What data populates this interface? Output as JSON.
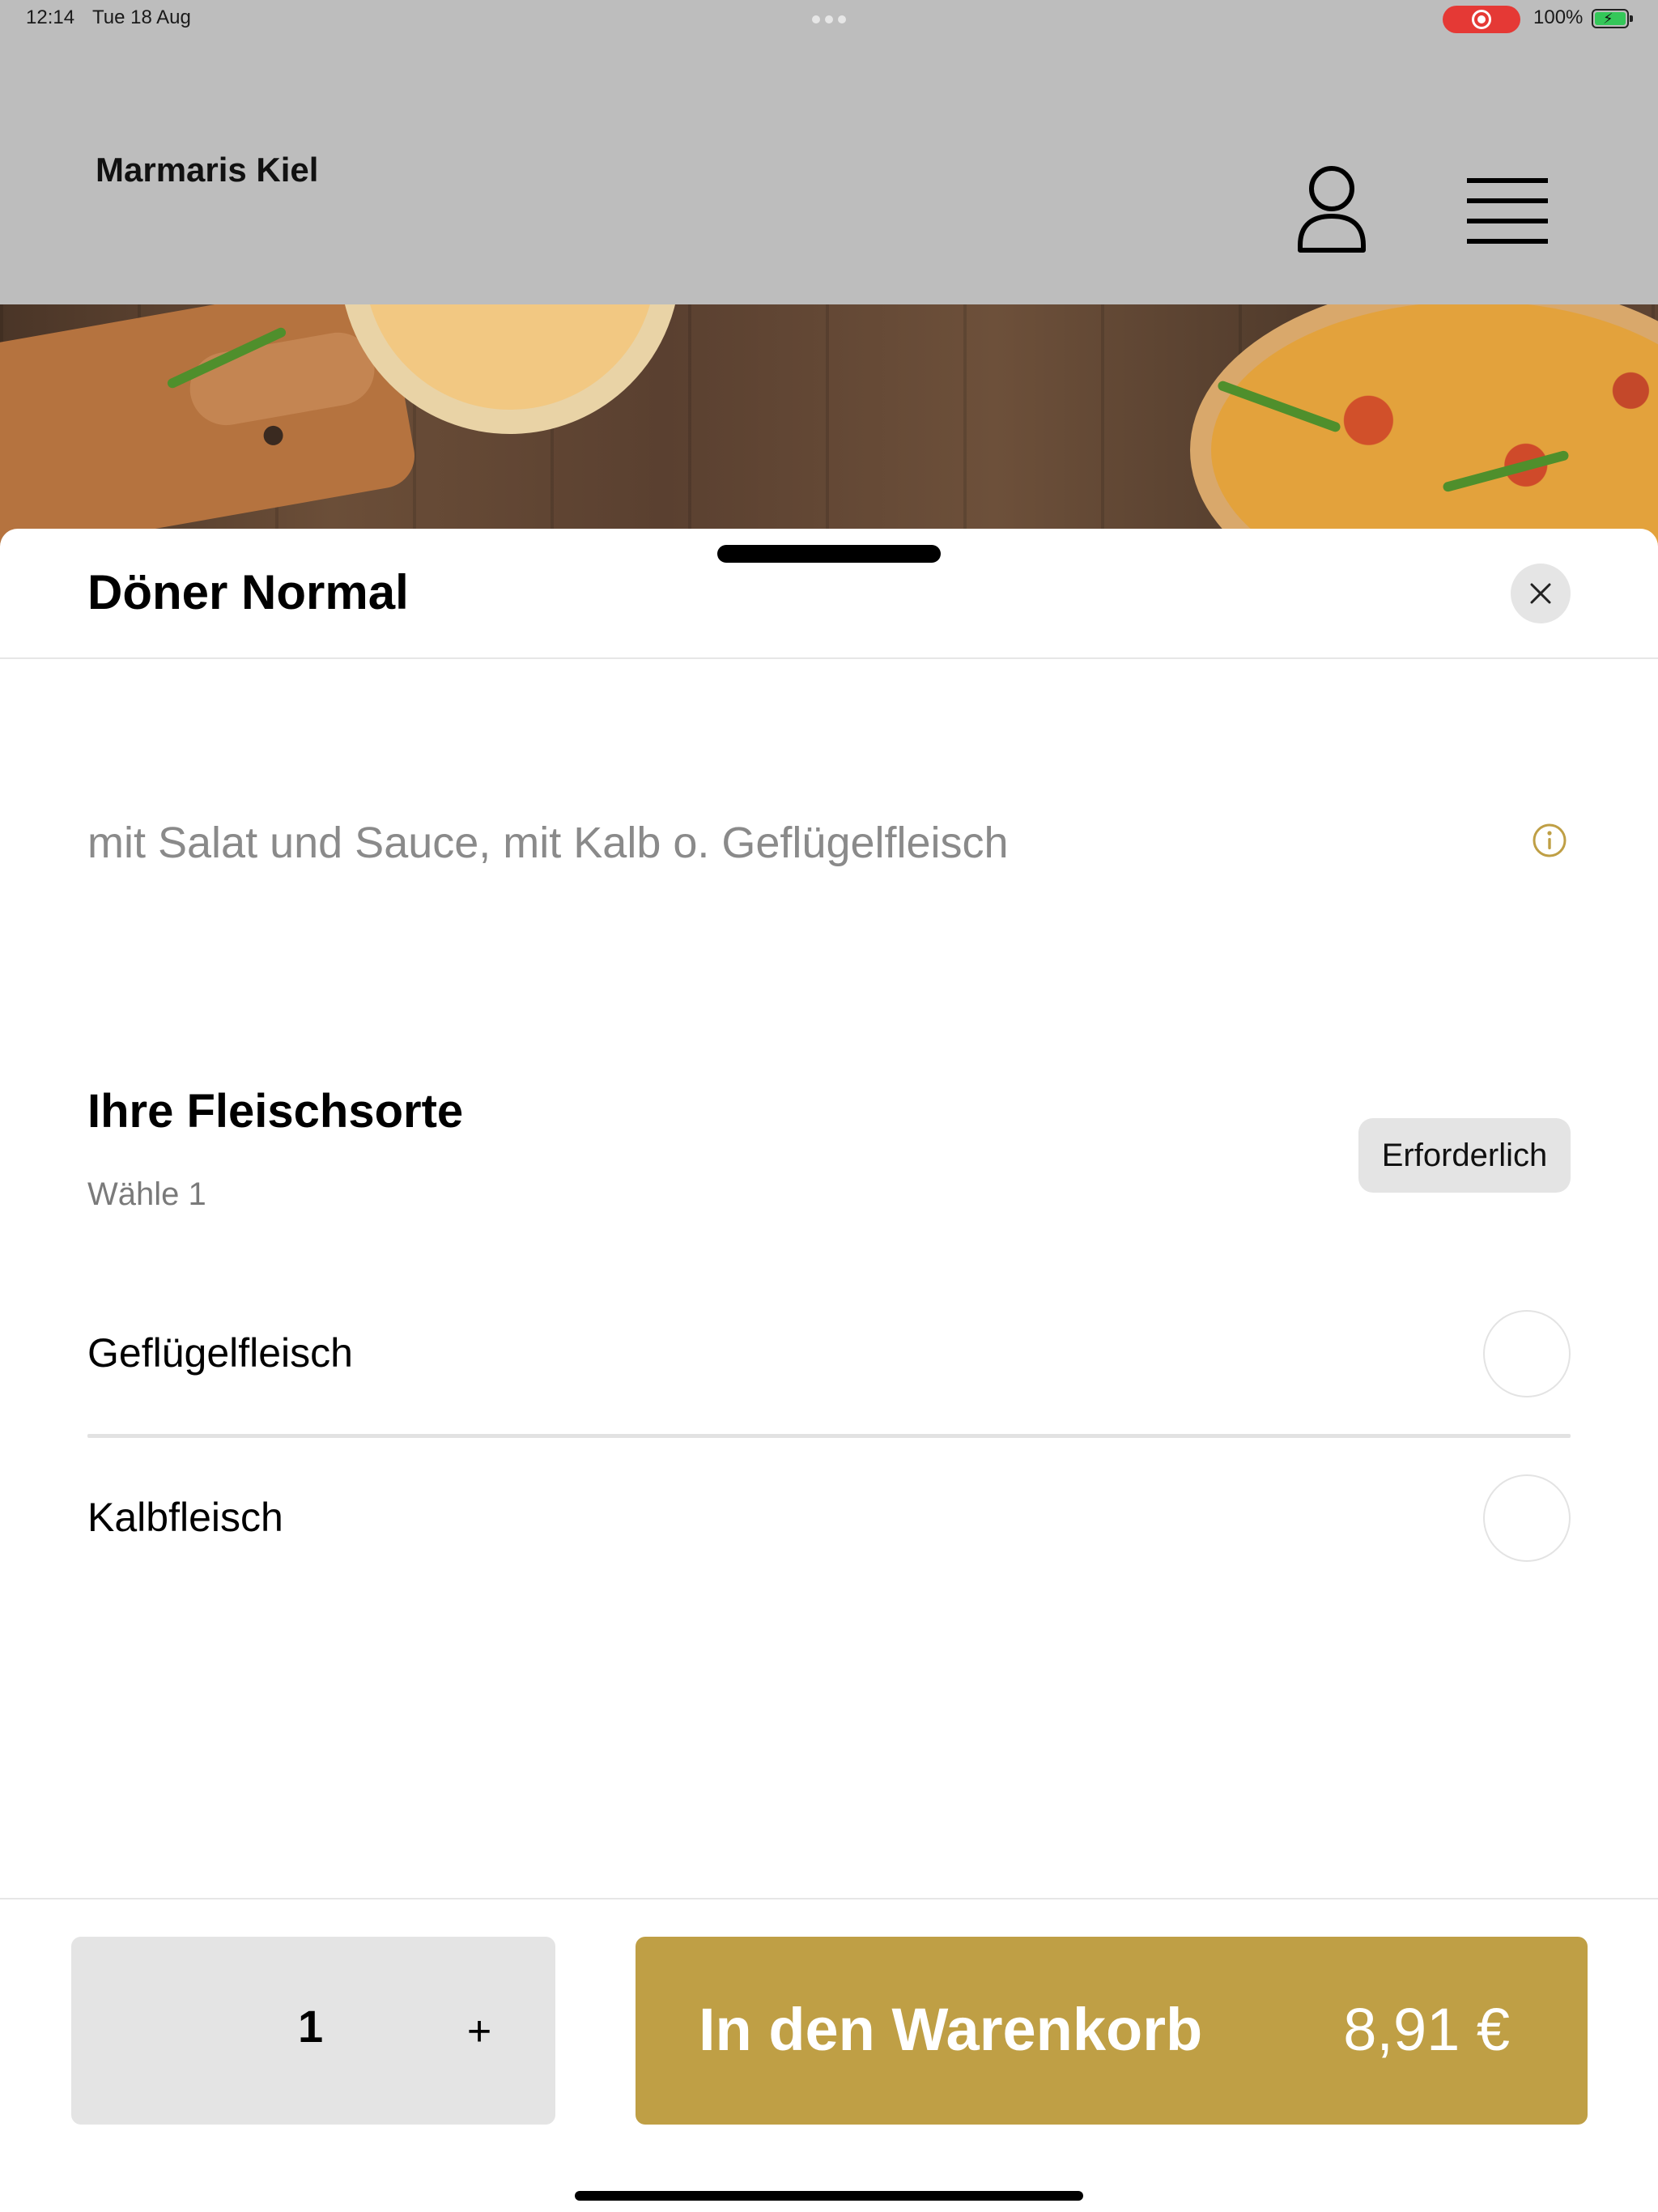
{
  "status_bar": {
    "time": "12:14",
    "date": "Tue 18 Aug",
    "battery_percent": "100%",
    "battery_level": 1.0,
    "recording": true
  },
  "header": {
    "brand": "Marmaris Kiel",
    "account_icon": "user-icon",
    "menu_icon": "hamburger-menu-icon"
  },
  "product": {
    "title": "Döner Normal",
    "description": "mit Salat und Sauce, mit Kalb o. Geflügelfleisch",
    "info_icon": "info-icon"
  },
  "option_group": {
    "title": "Ihre Fleischsorte",
    "subtitle": "Wähle 1",
    "badge": "Erforderlich",
    "options": [
      {
        "label": "Geflügelfleisch",
        "selected": false
      },
      {
        "label": "Kalbfleisch",
        "selected": false
      }
    ]
  },
  "footer": {
    "quantity": "1",
    "plus_label": "+",
    "add_to_cart": "In den Warenkorb",
    "price": "8,91 €"
  },
  "colors": {
    "accent": "#bf9f45",
    "header_bg": "#bdbdbd",
    "description_text": "#8a8a8a",
    "badge_bg": "#e4e4e4"
  }
}
